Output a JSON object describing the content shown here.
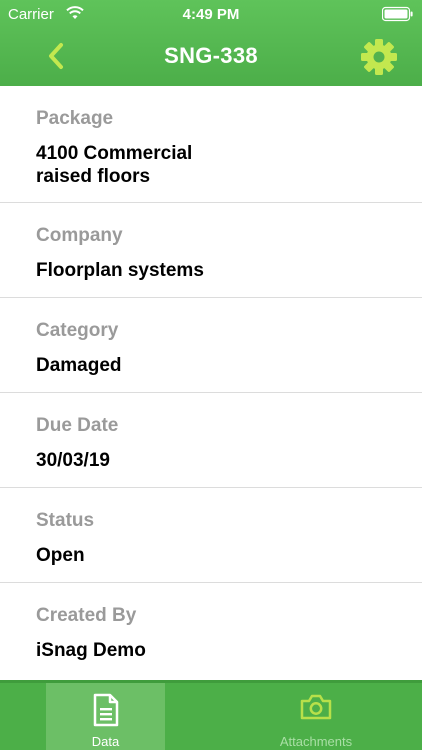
{
  "status_bar": {
    "carrier": "Carrier",
    "time": "4:49 PM"
  },
  "nav": {
    "title": "SNG-338",
    "back_icon": "chevron-left-icon",
    "settings_icon": "gear-icon"
  },
  "fields": [
    {
      "label": "Package",
      "value": "4100 Commercial raised floors"
    },
    {
      "label": "Company",
      "value": "Floorplan systems"
    },
    {
      "label": "Category",
      "value": "Damaged"
    },
    {
      "label": "Due Date",
      "value": "30/03/19"
    },
    {
      "label": "Status",
      "value": "Open"
    },
    {
      "label": "Created By",
      "value": "iSnag Demo"
    }
  ],
  "tabs": [
    {
      "label": "Data",
      "icon": "document-icon",
      "selected": true
    },
    {
      "label": "Attachments",
      "icon": "camera-icon",
      "selected": false
    }
  ],
  "colors": {
    "header_green": "#4cae49",
    "accent_lime": "#b7e04a",
    "tab_active_bg": "#6cbf66",
    "label_gray": "#9a9a9a"
  }
}
